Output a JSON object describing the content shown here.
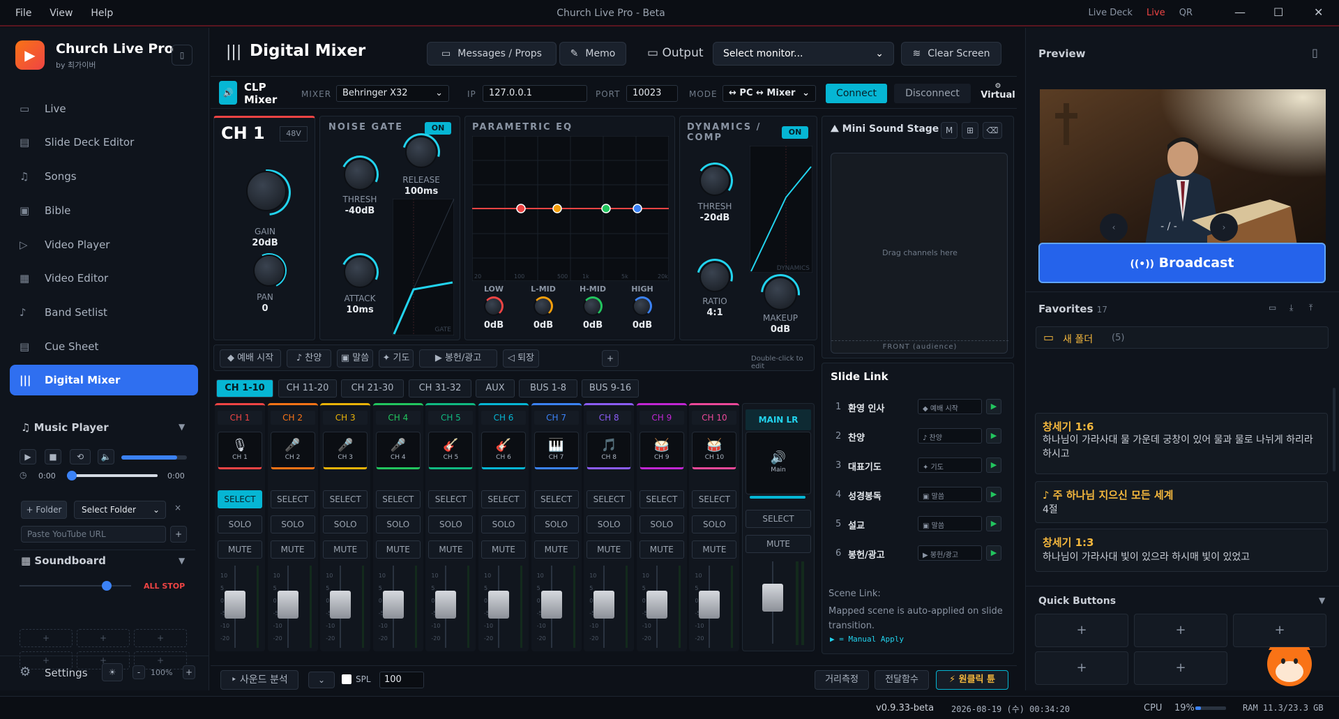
{
  "titlebar": {
    "menu": [
      "File",
      "View",
      "Help"
    ],
    "title": "Church Live Pro - Beta",
    "right": [
      "Live Deck",
      "Live",
      "QR"
    ]
  },
  "sidebar": {
    "app_name": "Church Live Pro",
    "app_by": "by 최가이버",
    "items": [
      {
        "label": "Live",
        "icon": "video-icon"
      },
      {
        "label": "Slide Deck Editor",
        "icon": "slides-icon"
      },
      {
        "label": "Songs",
        "icon": "music-note-icon"
      },
      {
        "label": "Bible",
        "icon": "book-icon"
      },
      {
        "label": "Video Player",
        "icon": "play-icon"
      },
      {
        "label": "Video Editor",
        "icon": "film-icon"
      },
      {
        "label": "Band Setlist",
        "icon": "setlist-icon"
      },
      {
        "label": "Cue Sheet",
        "icon": "clipboard-icon"
      },
      {
        "label": "Digital Mixer",
        "icon": "mixer-icon"
      }
    ],
    "music_player": {
      "title": "Music Player",
      "time_start": "0:00",
      "time_end": "0:00",
      "volume_fraction": 0.85,
      "folder_btn": "+ Folder",
      "select_folder": "Select Folder",
      "youtube_placeholder": "Paste YouTube URL"
    },
    "soundboard": {
      "title": "Soundboard",
      "all_stop": "ALL STOP",
      "volume_fraction": 0.75,
      "slot": "+"
    },
    "settings": {
      "label": "Settings",
      "zoom": "100%",
      "minus": "-",
      "plus": "+"
    }
  },
  "header": {
    "title": "Digital Mixer",
    "messages": "Messages / Props",
    "memo": "Memo",
    "output_label": "Output",
    "monitor": "Select monitor...",
    "clear": "Clear Screen"
  },
  "clp": {
    "title_1": "CLP",
    "title_2": "Mixer",
    "mixer_label": "MIXER",
    "mixer": "Behringer X32",
    "ip_label": "IP",
    "ip": "127.0.0.1",
    "port_label": "PORT",
    "port": "10023",
    "mode_label": "MODE",
    "mode": "↔ PC ↔ Mixer",
    "connect": "Connect",
    "disconnect": "Disconnect",
    "virtual": "Virtual"
  },
  "ch": {
    "name": "CH 1",
    "phantom": "48V",
    "gain_label": "GAIN",
    "gain": "20dB",
    "pan_label": "PAN",
    "pan": "0"
  },
  "gate": {
    "title": "NOISE GATE",
    "on": "ON",
    "thresh_label": "THRESH",
    "thresh": "-40dB",
    "release_label": "RELEASE",
    "release": "100ms",
    "attack_label": "ATTACK",
    "attack": "10ms",
    "graph": "GATE"
  },
  "eq": {
    "title": "PARAMETRIC EQ",
    "freqs": [
      "20",
      "100",
      "500",
      "1k",
      "5k",
      "20k"
    ],
    "bands": [
      {
        "label": "LOW",
        "value": "0dB",
        "color": "#ef4444"
      },
      {
        "label": "L-MID",
        "value": "0dB",
        "color": "#f59e0b"
      },
      {
        "label": "H-MID",
        "value": "0dB",
        "color": "#22c55e"
      },
      {
        "label": "HIGH",
        "value": "0dB",
        "color": "#3b82f6"
      }
    ]
  },
  "dyn": {
    "title_1": "DYNAMICS /",
    "title_2": "COMP",
    "on": "ON",
    "thresh_label": "THRESH",
    "thresh": "-20dB",
    "ratio_label": "RATIO",
    "ratio": "4:1",
    "makeup_label": "MAKEUP",
    "makeup": "0dB",
    "graph": "DYNAMICS"
  },
  "stage": {
    "title": "Mini Sound Stage",
    "m": "M",
    "hint": "Drag channels here",
    "front": "FRONT (audience)"
  },
  "scenes": {
    "items": [
      "◆ 예배 시작",
      "♪ 찬양",
      "▣ 말씀",
      "✦ 기도",
      "▶ 봉헌/광고",
      "◁ 퇴장"
    ],
    "add": "+",
    "hint": "Double-click to edit"
  },
  "tabs": [
    "CH 1-10",
    "CH 11-20",
    "CH 21-30",
    "CH 31-32",
    "AUX",
    "BUS 1-8",
    "BUS 9-16"
  ],
  "channels": [
    {
      "name": "CH 1",
      "short": "CH 1",
      "glyph": "🎙",
      "color": "#ef4444"
    },
    {
      "name": "CH 2",
      "short": "CH 2",
      "glyph": "🎤",
      "color": "#f97316"
    },
    {
      "name": "CH 3",
      "short": "CH 3",
      "glyph": "🎤",
      "color": "#eab308"
    },
    {
      "name": "CH 4",
      "short": "CH 4",
      "glyph": "🎤",
      "color": "#22c55e"
    },
    {
      "name": "CH 5",
      "short": "CH 5",
      "glyph": "🎸",
      "color": "#10b981"
    },
    {
      "name": "CH 6",
      "short": "CH 6",
      "glyph": "🎸",
      "color": "#06b6d4"
    },
    {
      "name": "CH 7",
      "short": "CH 7",
      "glyph": "🎹",
      "color": "#3b82f6"
    },
    {
      "name": "CH 8",
      "short": "CH 8",
      "glyph": "🎵",
      "color": "#8b5cf6"
    },
    {
      "name": "CH 9",
      "short": "CH 9",
      "glyph": "🥁",
      "color": "#c026d3"
    },
    {
      "name": "CH 10",
      "short": "CH 10",
      "glyph": "🥁",
      "color": "#ec4899"
    }
  ],
  "strip_btns": {
    "select": "SELECT",
    "solo": "SOLO",
    "mute": "MUTE"
  },
  "main": {
    "name": "MAIN LR",
    "short": "Main",
    "select": "SELECT",
    "mute": "MUTE"
  },
  "fader_ticks": [
    "10",
    "5",
    "0",
    "-5",
    "-10",
    "-20"
  ],
  "slidelink": {
    "title": "Slide Link",
    "rows": [
      {
        "n": "1",
        "t": "환영 인사",
        "s": "◆ 예배 시작"
      },
      {
        "n": "2",
        "t": "찬양",
        "s": "♪ 찬양"
      },
      {
        "n": "3",
        "t": "대표기도",
        "s": "✦ 기도"
      },
      {
        "n": "4",
        "t": "성경봉독",
        "s": "▣ 말씀"
      },
      {
        "n": "5",
        "t": "설교",
        "s": "▣ 말씀"
      },
      {
        "n": "6",
        "t": "봉헌/광고",
        "s": "▶ 봉헌/광고"
      }
    ],
    "scene_link": "Scene Link:",
    "note": "Mapped scene is auto-applied on slide transition.",
    "manual": "▶ = Manual Apply"
  },
  "bottom": {
    "analysis": "사운드 분석",
    "spl": "SPL",
    "spl_value": "100",
    "distance": "거리측정",
    "transfer": "전달함수",
    "oneclick": "⚡ 원클릭 튠"
  },
  "preview": {
    "title": "Preview",
    "pager": "- / -",
    "broadcast": "Broadcast"
  },
  "favorites": {
    "title": "Favorites",
    "count": "17",
    "folder": "새 폴더",
    "folder_count": "(5)",
    "items": [
      {
        "h": "창세기 1:6",
        "b": "하나님이 가라사대 물 가운데 궁창이 있어 물과 물로 나뉘게 하리라 하시고"
      },
      {
        "h": "♪ 주 하나님 지으신 모든 세계",
        "b": "4절"
      },
      {
        "h": "창세기 1:3",
        "b": "하나님이 가라사대 빛이 있으라 하시매 빛이 있었고"
      }
    ]
  },
  "quick": {
    "title": "Quick Buttons",
    "slot": "+"
  },
  "status": {
    "version": "v0.9.33-beta",
    "datetime": "2026-08-19 (수) 00:34:20",
    "cpu_label": "CPU",
    "cpu": "19%",
    "cpu_fraction": 0.19,
    "ram": "RAM 11.3/23.3 GB"
  },
  "colors": {
    "accent": "#06b6d4",
    "primary": "#2f6ff0",
    "live": "#ef4444"
  }
}
